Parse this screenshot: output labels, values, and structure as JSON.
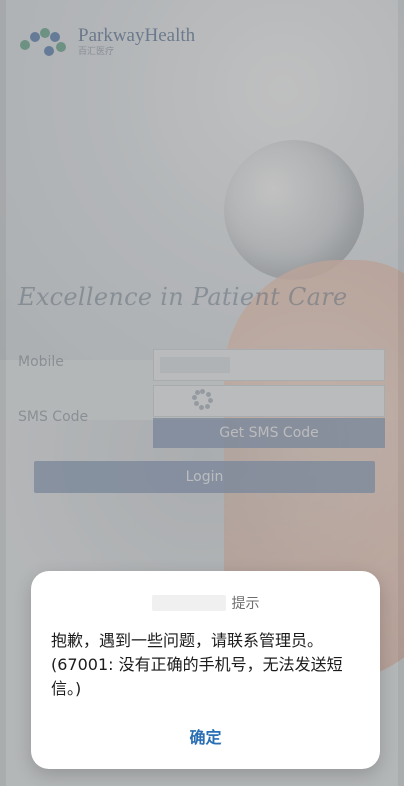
{
  "app": {
    "brand_name": "ParkwayHealth",
    "brand_subtitle": "百汇医疗",
    "tagline": "Excellence in Patient Care"
  },
  "form": {
    "mobile_label": "Mobile",
    "sms_code_label": "SMS Code",
    "mobile_value": "",
    "sms_code_value": "",
    "get_sms_code_button": "Get SMS Code",
    "login_button": "Login"
  },
  "dialog": {
    "title_visible": "提示",
    "message": "抱歉，遇到一些问题，请联系管理员。(67001: 没有正确的手机号，无法发送短信。)",
    "confirm_button": "确定"
  },
  "colors": {
    "button_bg": "#7e93b3",
    "dialog_confirm": "#2a6fb4",
    "overlay": "#808080"
  },
  "icons": {
    "loading": "spinner-icon",
    "logo_mark": "parkway-logo-icon"
  }
}
